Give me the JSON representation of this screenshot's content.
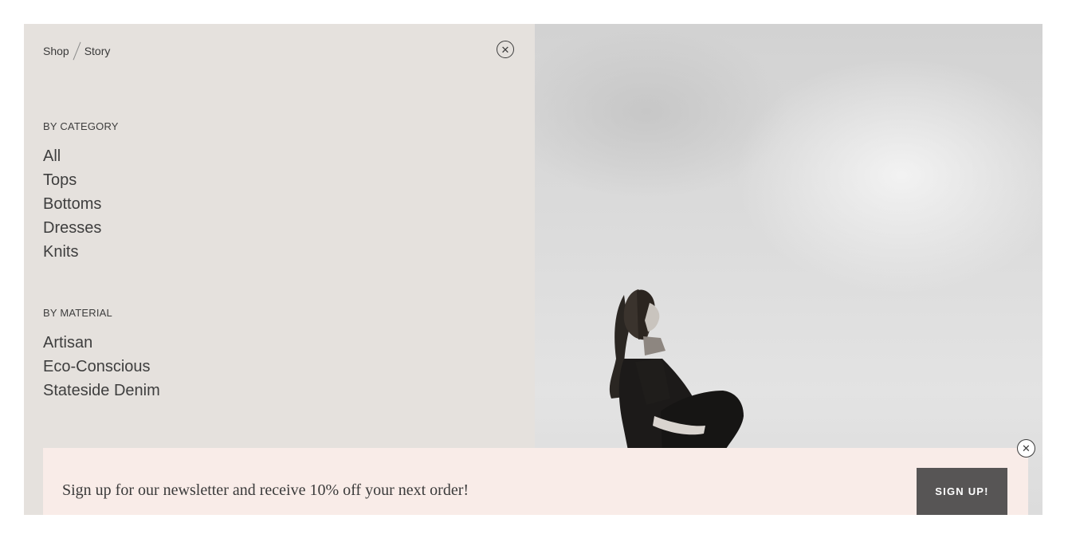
{
  "breadcrumb": {
    "shop": "Shop",
    "story": "Story"
  },
  "menu": {
    "close_icon": "close-icon",
    "category_heading": "BY CATEGORY",
    "categories": [
      "All",
      "Tops",
      "Bottoms",
      "Dresses",
      "Knits"
    ],
    "material_heading": "BY MATERIAL",
    "materials": [
      "Artisan",
      "Eco-Conscious",
      "Stateside Denim"
    ]
  },
  "newsletter": {
    "text": "Sign up for our newsletter and receive 10% off your next order!",
    "button_label": "SIGN UP!",
    "close_icon": "close-icon"
  },
  "colors": {
    "menu_bg": "#e5e1dd",
    "newsletter_bg": "#f9ece8",
    "button_bg": "#575555"
  }
}
